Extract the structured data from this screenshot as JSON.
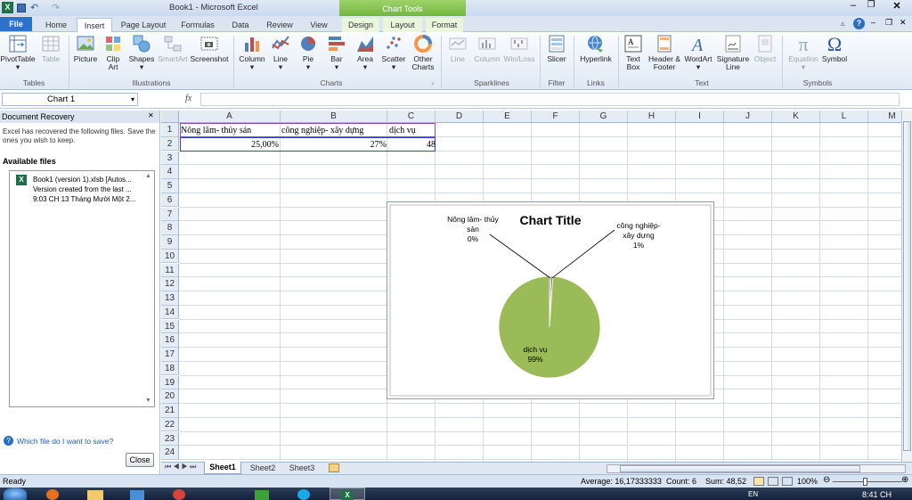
{
  "window": {
    "title": "Book1 - Microsoft Excel",
    "context_tab_group": "Chart Tools"
  },
  "tabs": [
    "File",
    "Home",
    "Insert",
    "Page Layout",
    "Formulas",
    "Data",
    "Review",
    "View",
    "Design",
    "Layout",
    "Format"
  ],
  "active_tab": "Insert",
  "ribbon": {
    "tables": {
      "label": "Tables",
      "items": [
        "PivotTable",
        "Table"
      ]
    },
    "illustrations": {
      "label": "Illustrations",
      "items": [
        "Picture",
        "Clip Art",
        "Shapes",
        "SmartArt",
        "Screenshot"
      ]
    },
    "charts": {
      "label": "Charts",
      "items": [
        "Column",
        "Line",
        "Pie",
        "Bar",
        "Area",
        "Scatter",
        "Other Charts"
      ]
    },
    "sparklines": {
      "label": "Sparklines",
      "items": [
        "Line",
        "Column",
        "Win/Loss"
      ]
    },
    "filter": {
      "label": "Filter",
      "items": [
        "Slicer"
      ]
    },
    "links": {
      "label": "Links",
      "items": [
        "Hyperlink"
      ]
    },
    "text": {
      "label": "Text",
      "items": [
        "Text Box",
        "Header & Footer",
        "WordArt",
        "Signature Line",
        "Object"
      ]
    },
    "symbols": {
      "label": "Symbols",
      "items": [
        "Equation",
        "Symbol"
      ]
    }
  },
  "formula_bar": {
    "name_box": "Chart 1",
    "fx": "fx",
    "formula": ""
  },
  "doc_recovery": {
    "title": "Document Recovery",
    "message": "Excel has recovered the following files.  Save the ones you wish to keep.",
    "available_label": "Available files",
    "file_name": "Book1 (version 1).xlsb  [Autos...",
    "file_version": "Version created from the last ...",
    "file_time": "9:03 CH 13 Tháng Mười Một 2...",
    "help_link": "Which file do I want to save?",
    "close_button": "Close"
  },
  "columns": [
    "A",
    "B",
    "C",
    "D",
    "E",
    "F",
    "G",
    "H",
    "I",
    "J",
    "K",
    "L",
    "M"
  ],
  "rows": [
    "1",
    "2",
    "3",
    "4",
    "5",
    "6",
    "7",
    "8",
    "9",
    "10",
    "11",
    "12",
    "13",
    "14",
    "15",
    "16",
    "17",
    "18",
    "19",
    "20",
    "21",
    "22",
    "23",
    "24"
  ],
  "cells": {
    "A1": "Nông lâm- thủy sản",
    "B1": "công nghiệp- xây dựng",
    "C1": "dịch vụ",
    "A2": "25,00%",
    "B2": "27%",
    "C2": "48"
  },
  "chart_data": {
    "type": "pie",
    "title": "Chart Title",
    "categories": [
      "Nông lâm- thủy sản",
      "công nghiệp- xây dựng",
      "dịch vụ"
    ],
    "values": [
      0.25,
      0.27,
      48
    ],
    "percent_labels": [
      "0%",
      "1%",
      "99%"
    ],
    "colors": [
      "#4f81bd",
      "#c0504d",
      "#9bbb59"
    ]
  },
  "sheet_tabs": [
    "Sheet1",
    "Sheet2",
    "Sheet3"
  ],
  "active_sheet": "Sheet1",
  "status": {
    "ready": "Ready",
    "average": "Average: 16,17333333",
    "count": "Count: 6",
    "sum": "Sum: 48,52",
    "zoom": "100%"
  },
  "clock": {
    "time": "8:41 CH",
    "lang": "EN"
  }
}
